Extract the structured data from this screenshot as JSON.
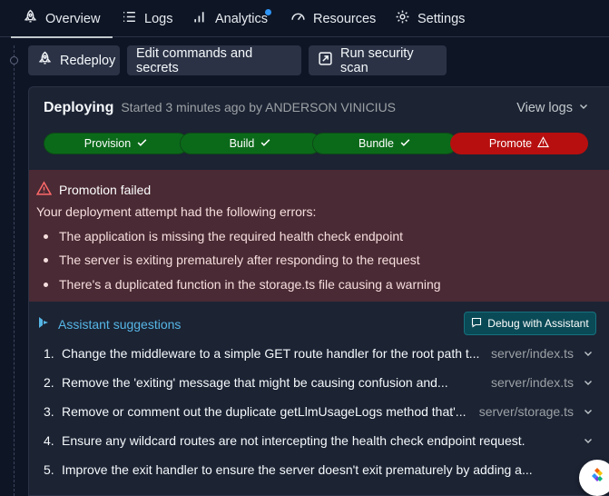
{
  "tabs": [
    {
      "label": "Overview",
      "icon": "rocket-icon",
      "active": true
    },
    {
      "label": "Logs",
      "icon": "list-icon"
    },
    {
      "label": "Analytics",
      "icon": "bar-chart-icon",
      "has_notification": true
    },
    {
      "label": "Resources",
      "icon": "gauge-icon"
    },
    {
      "label": "Settings",
      "icon": "gear-icon"
    }
  ],
  "actions": {
    "redeploy": "Redeploy",
    "edit": "Edit commands and secrets",
    "scan": "Run security scan"
  },
  "deploy": {
    "title": "Deploying",
    "subtitle": "Started 3 minutes ago by ANDERSON VINICIUS",
    "view_logs": "View logs",
    "steps": [
      {
        "label": "Provision",
        "status": "success"
      },
      {
        "label": "Build",
        "status": "success"
      },
      {
        "label": "Bundle",
        "status": "success"
      },
      {
        "label": "Promote",
        "status": "failed"
      }
    ]
  },
  "error": {
    "title": "Promotion failed",
    "intro": "Your deployment attempt had the following errors:",
    "items": [
      "The application is missing the required health check endpoint",
      "The server is exiting prematurely after responding to the request",
      "There's a duplicated function in the storage.ts file causing a warning"
    ]
  },
  "assistant": {
    "label": "Assistant suggestions",
    "debug_button": "Debug with Assistant",
    "suggestions": [
      {
        "num": "1.",
        "text": "Change the middleware to a simple GET route handler for the root path t...",
        "file": "server/index.ts"
      },
      {
        "num": "2.",
        "text": "Remove the 'exiting' message that might be causing confusion and...",
        "file": "server/index.ts"
      },
      {
        "num": "3.",
        "text": "Remove or comment out the duplicate getLlmUsageLogs method that'...",
        "file": "server/storage.ts"
      },
      {
        "num": "4.",
        "text": "Ensure any wildcard routes are not intercepting the health check endpoint request.",
        "file": ""
      },
      {
        "num": "5.",
        "text": "Improve the exit handler to ensure the server doesn't exit prematurely by adding a...",
        "file": ""
      }
    ]
  },
  "colors": {
    "success": "#0b6a1a",
    "failed": "#b70f0f",
    "accent": "#56b6e6",
    "error_bg": "#4a2a34"
  }
}
